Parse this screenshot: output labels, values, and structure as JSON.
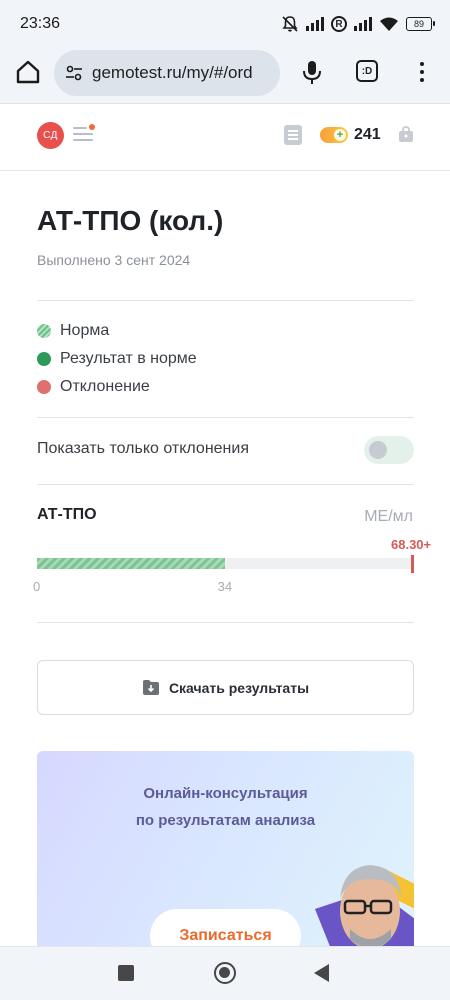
{
  "status_bar": {
    "time": "23:36",
    "battery": "89"
  },
  "browser": {
    "url": "gemotest.ru/my/#/ord",
    "tabs_label": ":D"
  },
  "header": {
    "avatar_initials": "СД",
    "points": "241"
  },
  "analysis": {
    "title": "АТ-ТПО (кол.)",
    "subtitle": "Выполнено 3 сент 2024"
  },
  "legend": [
    {
      "label": "Норма"
    },
    {
      "label": "Результат в норме"
    },
    {
      "label": "Отклонение"
    }
  ],
  "filter": {
    "label": "Показать только отклонения",
    "enabled": false
  },
  "result": {
    "name": "АТ-ТПО",
    "unit": "МЕ/мл",
    "value_label": "68.30+",
    "range_min": 0,
    "range_max": 34,
    "value": 68.3,
    "scale_max": 68.3,
    "tick_min": "0",
    "tick_max": "34"
  },
  "download": {
    "label": "Скачать результаты"
  },
  "promo": {
    "line1": "Онлайн-консультация",
    "line2": "по результатам анализа",
    "button": "Записаться"
  },
  "colors": {
    "norm": "#7cc494",
    "in_norm": "#2e9a5a",
    "deviation": "#d65a57",
    "accent": "#ee6a2c"
  }
}
